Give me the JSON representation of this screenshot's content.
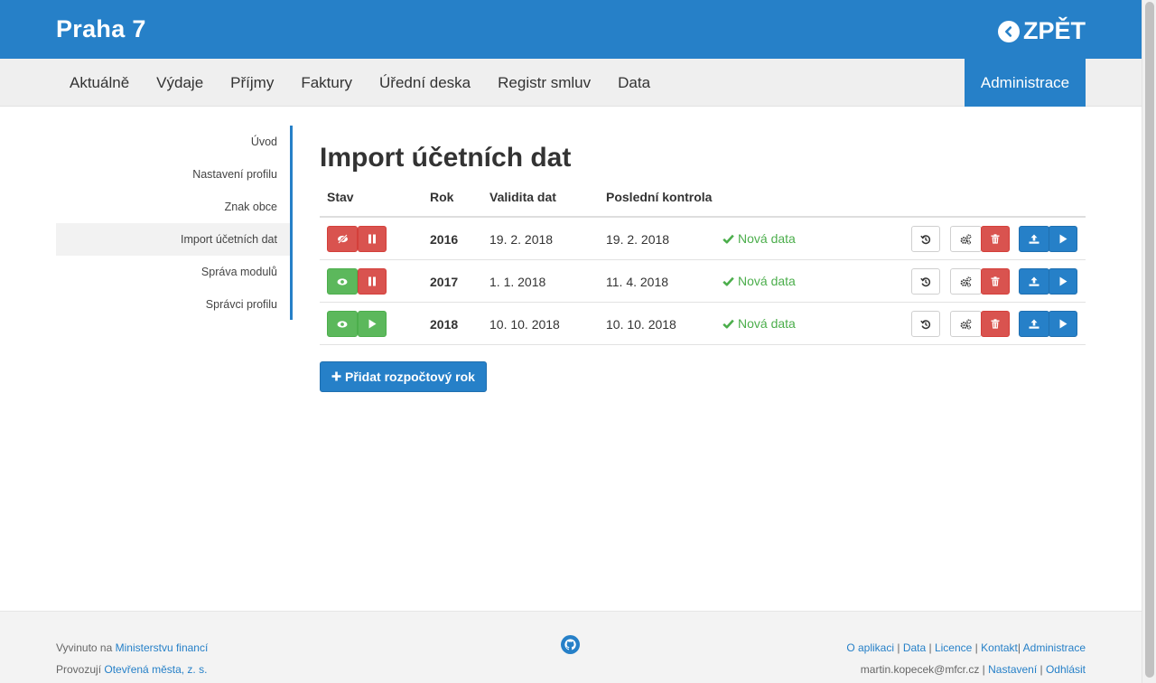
{
  "header": {
    "brand": "Praha 7",
    "back_label": "ZPĚT"
  },
  "nav": {
    "items": [
      "Aktuálně",
      "Výdaje",
      "Příjmy",
      "Faktury",
      "Úřední deska",
      "Registr smluv",
      "Data"
    ],
    "admin": "Administrace"
  },
  "sidebar": {
    "items": [
      "Úvod",
      "Nastavení profilu",
      "Znak obce",
      "Import účetních dat",
      "Správa modulů",
      "Správci profilu"
    ],
    "active_index": 3
  },
  "main": {
    "title": "Import účetních dat",
    "columns": {
      "stav": "Stav",
      "rok": "Rok",
      "validita": "Validita dat",
      "kontrola": "Poslední kontrola"
    },
    "rows": [
      {
        "year": "2016",
        "validity": "19. 2. 2018",
        "last_check": "19. 2. 2018",
        "status": "Nová data",
        "visible": false,
        "running": true
      },
      {
        "year": "2017",
        "validity": "1. 1. 2018",
        "last_check": "11. 4. 2018",
        "status": "Nová data",
        "visible": true,
        "running": true
      },
      {
        "year": "2018",
        "validity": "10. 10. 2018",
        "last_check": "10. 10. 2018",
        "status": "Nová data",
        "visible": true,
        "running": false
      }
    ],
    "add_button": "Přidat rozpočtový rok"
  },
  "footer": {
    "developed_prefix": "Vyvinuto na",
    "developed_link": "Ministerstvu financí",
    "operated_prefix": "Provozují",
    "operated_link": "Otevřená města, z. s.",
    "links": [
      "O aplikaci",
      "Data",
      "Licence",
      "Kontakt",
      "Administrace"
    ],
    "user_email": "martin.kopecek@mfcr.cz",
    "user_links": [
      "Nastavení",
      "Odhlásit"
    ]
  },
  "colors": {
    "primary": "#2680c8",
    "success": "#5cb85c",
    "danger": "#d9534f"
  },
  "icons": {
    "visible_toggle": "eye-icon",
    "hidden_toggle": "eye-slash-icon",
    "pause": "pause-icon",
    "play": "play-icon",
    "history": "history-icon",
    "settings": "cogs-icon",
    "delete": "trash-icon",
    "upload": "upload-icon",
    "run": "play-icon",
    "status_ok": "check-icon",
    "back": "chevron-left-icon",
    "github": "github-icon",
    "add": "plus-icon"
  }
}
